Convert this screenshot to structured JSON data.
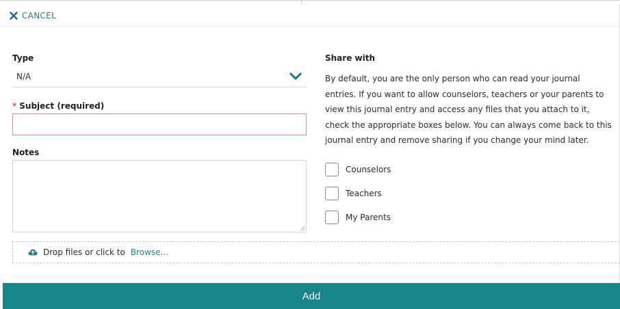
{
  "header": {
    "cancel_label": "CANCEL"
  },
  "form": {
    "type": {
      "label": "Type",
      "selected": "N/A"
    },
    "subject": {
      "label": "Subject (required)",
      "required_marker": "*",
      "value": ""
    },
    "notes": {
      "label": "Notes",
      "value": ""
    }
  },
  "share": {
    "title": "Share with",
    "description": "By default, you are the only person who can read your journal entries. If you want to allow counselors, teachers or your parents to view this journal entry and access any files that you attach to it, check the appropriate boxes below. You can always come back to this journal entry and remove sharing if you change your mind later.",
    "options": [
      {
        "label": "Counselors",
        "checked": false
      },
      {
        "label": "Teachers",
        "checked": false
      },
      {
        "label": "My Parents",
        "checked": false
      }
    ]
  },
  "upload": {
    "text": "Drop files or click to",
    "link": "Browse..."
  },
  "footer": {
    "add_label": "Add"
  },
  "colors": {
    "accent": "#16858a",
    "link": "#1f7f86",
    "error_border": "#e58a86"
  },
  "icons": {
    "cancel": "close-icon",
    "type_dropdown": "chevron-down-icon",
    "upload": "cloud-upload-icon"
  }
}
